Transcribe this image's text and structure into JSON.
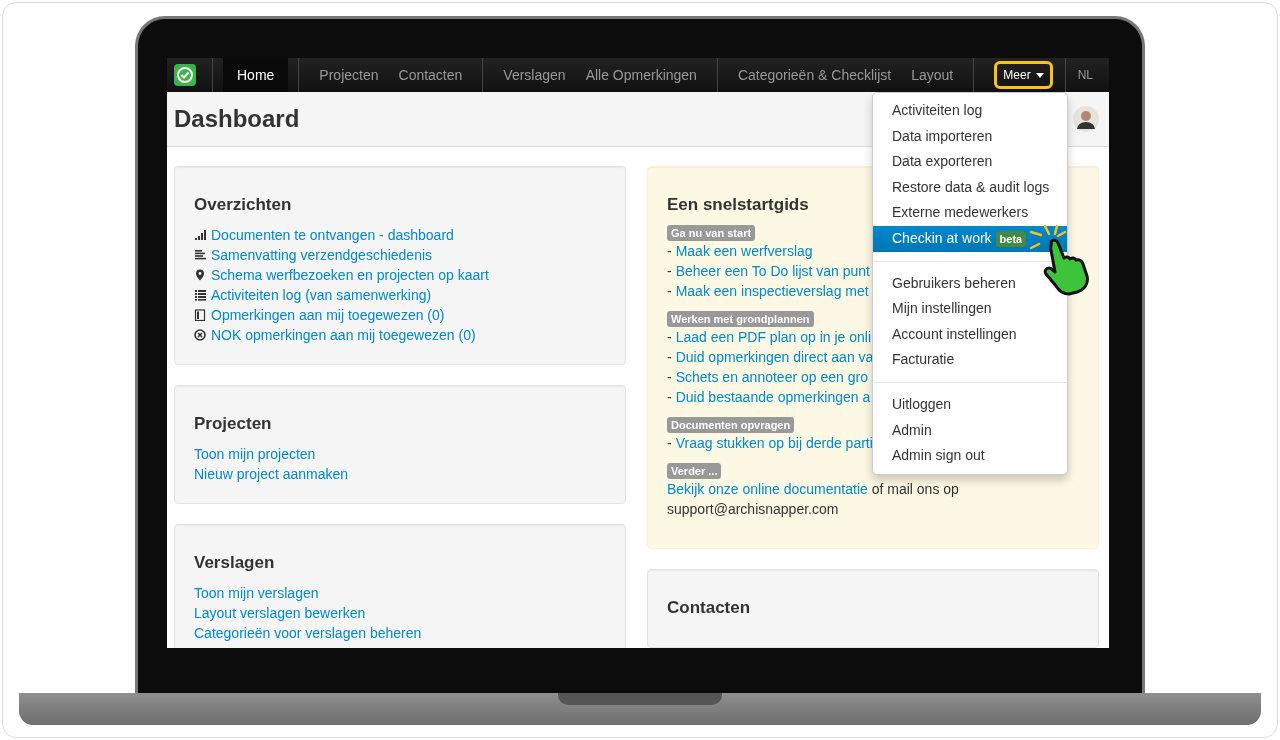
{
  "nav": {
    "groups": [
      {
        "items": [
          {
            "label": "Home",
            "selected": true
          }
        ]
      },
      {
        "items": [
          {
            "label": "Projecten",
            "selected": false
          },
          {
            "label": "Contacten",
            "selected": false
          }
        ]
      },
      {
        "items": [
          {
            "label": "Verslagen",
            "selected": false
          },
          {
            "label": "Alle Opmerkingen",
            "selected": false
          }
        ]
      },
      {
        "items": [
          {
            "label": "Categorieën & Checklijst",
            "selected": false
          },
          {
            "label": "Layout",
            "selected": false
          }
        ]
      }
    ],
    "more": {
      "label": "Meer",
      "expanded": true
    },
    "language": "NL"
  },
  "header": {
    "title": "Dashboard"
  },
  "left_cards": [
    {
      "title": "Overzichten",
      "links": [
        {
          "label": "Documenten te ontvangen - dashboard",
          "kind": "signal"
        },
        {
          "label": "Samenvatting verzendgeschiedenis",
          "kind": "lines"
        },
        {
          "label": "Schema werfbezoeken en projecten op kaart",
          "kind": "pin"
        },
        {
          "label": "Activiteiten log (van samenwerking)",
          "kind": "list"
        },
        {
          "label": "Opmerkingen aan mij toegewezen (0)",
          "kind": "columns"
        },
        {
          "label": "NOK opmerkingen aan mij toegewezen (0)",
          "kind": "circle-x"
        }
      ]
    },
    {
      "title": "Projecten",
      "links": [
        {
          "label": "Toon mijn projecten"
        },
        {
          "label": "Nieuw project aanmaken"
        }
      ]
    },
    {
      "title": "Verslagen",
      "links": [
        {
          "label": "Toon mijn verslagen"
        },
        {
          "label": "Layout verslagen bewerken"
        },
        {
          "label": "Categorieën voor verslagen beheren"
        }
      ]
    }
  ],
  "quickstart": {
    "title": "Een snelstartgids",
    "sections": [
      {
        "badge": "Ga nu van start",
        "items": [
          {
            "marker": "-",
            "link": "Maak een werfverslag"
          },
          {
            "marker": "-",
            "link": "Beheer een To Do lijst van punt"
          },
          {
            "marker": "-",
            "link": "Maak een inspectieverslag met"
          }
        ]
      },
      {
        "badge": "Werken met grondplannen",
        "items": [
          {
            "marker": "-",
            "link": "Laad een PDF plan op in je onli"
          },
          {
            "marker": "-",
            "link": "Duid opmerkingen direct aan va"
          },
          {
            "marker": "-",
            "link": "Schets en annoteer op een gro"
          },
          {
            "marker": "-",
            "link": "Duid bestaande opmerkingen a"
          }
        ]
      },
      {
        "badge": "Documenten opvragen",
        "items": [
          {
            "marker": "-",
            "link": "Vraag stukken op bij derde parti"
          }
        ]
      }
    ],
    "more": {
      "badge": "Verder ...",
      "link": "Bekijk onze online documentatie",
      "text": "of mail ons op support@archisnapper.com"
    }
  },
  "contacts_card": {
    "title": "Contacten"
  },
  "menu": {
    "sections": [
      {
        "items": [
          {
            "label": "Activiteiten log",
            "selected": false
          },
          {
            "label": "Data importeren",
            "selected": false
          },
          {
            "label": "Data exporteren",
            "selected": false
          },
          {
            "label": "Restore data & audit logs",
            "selected": false
          },
          {
            "label": "Externe medewerkers",
            "selected": false
          },
          {
            "label": "Checkin at work",
            "selected": true,
            "badge": "beta"
          }
        ]
      },
      {
        "items": [
          {
            "label": "Gebruikers beheren",
            "selected": false
          },
          {
            "label": "Mijn instellingen",
            "selected": false
          },
          {
            "label": "Account instellingen",
            "selected": false
          },
          {
            "label": "Facturatie",
            "selected": false
          }
        ]
      },
      {
        "items": [
          {
            "label": "Uitloggen",
            "selected": false
          },
          {
            "label": "Admin",
            "selected": false
          },
          {
            "label": "Admin sign out",
            "selected": false
          }
        ]
      }
    ]
  }
}
